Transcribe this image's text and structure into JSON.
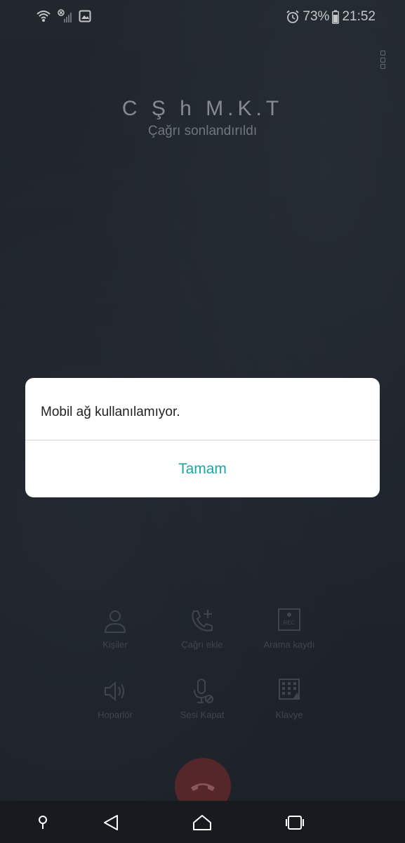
{
  "status_bar": {
    "battery": "73%",
    "time": "21:52",
    "icons": [
      "wifi-icon",
      "signal-off-icon",
      "image-icon",
      "alarm-icon",
      "battery-icon"
    ]
  },
  "call": {
    "caller_name": "C Ş h M.K.T",
    "status": "Çağrı sonlandırıldı"
  },
  "dialog": {
    "message": "Mobil ağ kullanılamıyor.",
    "ok_label": "Tamam",
    "accent": "#18a7a5"
  },
  "actions": [
    {
      "label": "Kişiler",
      "icon": "person-icon"
    },
    {
      "label": "Çağrı ekle",
      "icon": "add-call-icon"
    },
    {
      "label": "Arama kaydı",
      "icon": "record-icon",
      "badge": "REC"
    },
    {
      "label": "Hoparlör",
      "icon": "speaker-icon"
    },
    {
      "label": "Sesi Kapat",
      "icon": "mute-mic-icon"
    },
    {
      "label": "Klavye",
      "icon": "dialpad-icon"
    }
  ],
  "end_call": {
    "icon": "end-call-icon",
    "color": "#6b2c2f"
  },
  "nav": [
    "pin-icon",
    "back-icon",
    "home-icon",
    "recents-icon"
  ]
}
